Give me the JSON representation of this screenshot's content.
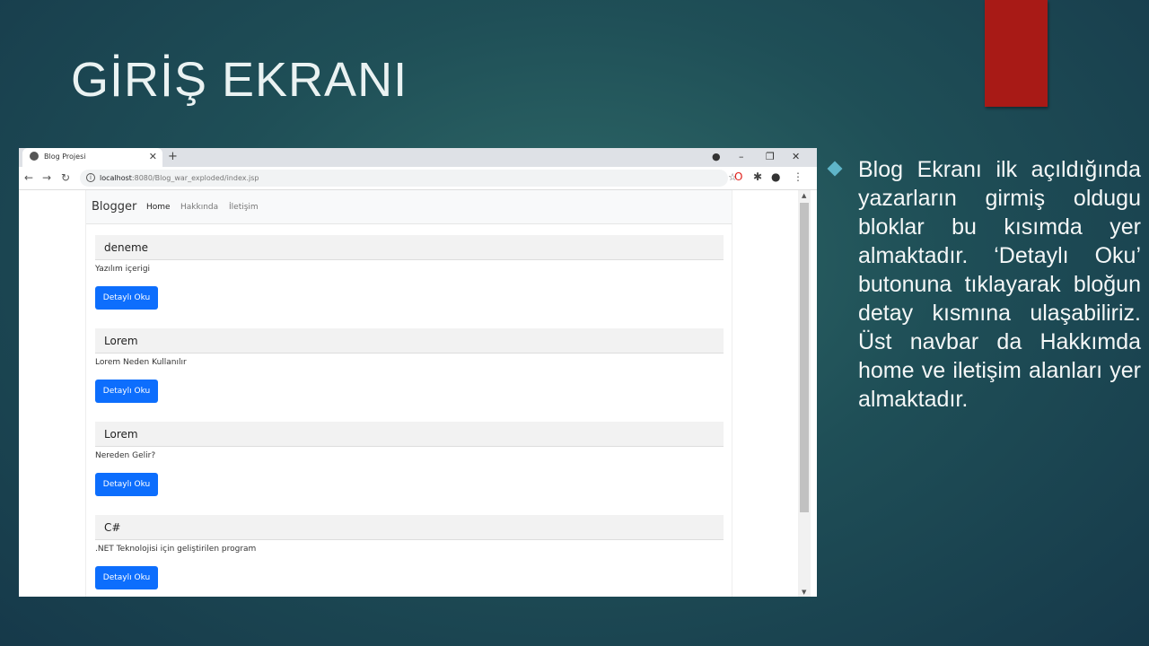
{
  "slide": {
    "title": "GİRİŞ EKRANI",
    "bullet": "Blog Ekranı ilk açıldığında yazarların girmiş oldugu bloklar bu kısımda yer almaktadır. ‘Detaylı Oku’ butonuna tıklayarak bloğun detay kısmına ulaşabiliriz. Üst navbar da Hakkımda home ve iletişim alanları yer almaktadır.",
    "colors": {
      "accent_bar": "#a81a16",
      "bullet": "#5fb5c9"
    }
  },
  "browser": {
    "tab_title": "Blog Projesi",
    "url_host": "localhost",
    "url_rest": ":8080/Blog_war_exploded/index.jsp"
  },
  "site": {
    "brand": "Blogger",
    "nav": [
      "Home",
      "Hakkında",
      "İletişim"
    ],
    "posts": [
      {
        "title": "deneme",
        "text": "Yazılım içerigi",
        "button": "Detaylı Oku"
      },
      {
        "title": "Lorem",
        "text": "Lorem Neden Kullanılır",
        "button": "Detaylı Oku"
      },
      {
        "title": "Lorem",
        "text": "Nereden Gelir?",
        "button": "Detaylı Oku"
      },
      {
        "title": "C#",
        "text": ".NET Teknolojisi için geliştirilen program",
        "button": "Detaylı Oku"
      }
    ],
    "colors": {
      "primary_button": "#0d6efd"
    }
  }
}
